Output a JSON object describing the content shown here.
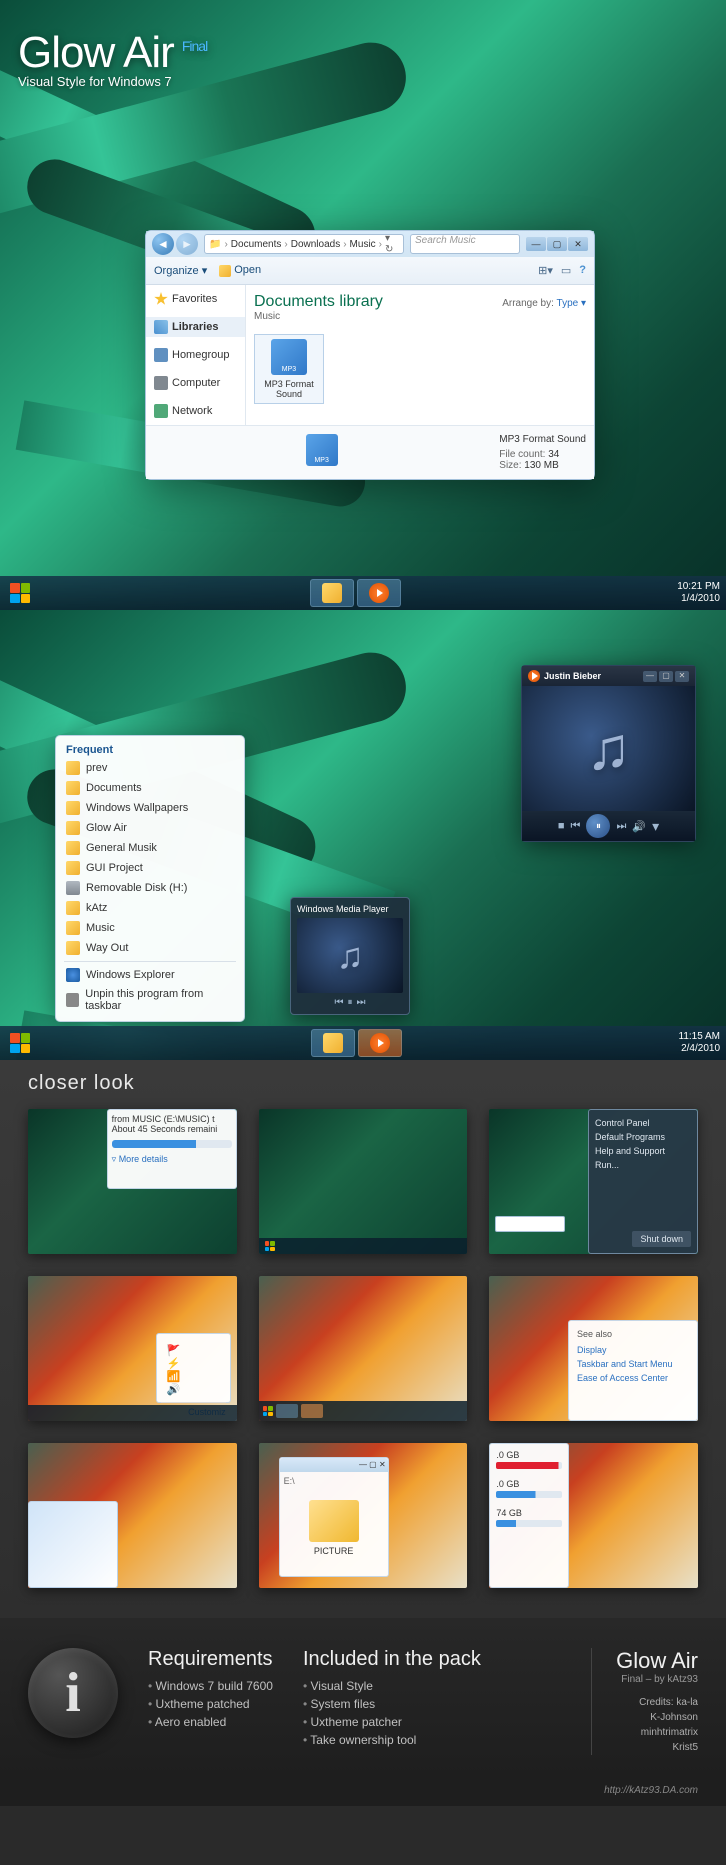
{
  "title": {
    "main": "Glow Air",
    "badge": "Final",
    "sub": "Visual Style for Windows 7"
  },
  "explorer": {
    "breadcrumb": [
      "Documents",
      "Downloads",
      "Music"
    ],
    "search_placeholder": "Search Music",
    "toolbar": {
      "organize": "Organize ▾",
      "open": "Open"
    },
    "toolbar_icons": {
      "view": "⊞▾",
      "preview": "▭",
      "help": "?"
    },
    "sidebar": {
      "favorites": "Favorites",
      "libraries": "Libraries",
      "homegroup": "Homegroup",
      "computer": "Computer",
      "network": "Network"
    },
    "header": {
      "title": "Documents library",
      "sub": "Music",
      "arrange": "Arrange by:",
      "arrange_val": "Type ▾"
    },
    "file": {
      "name": "MP3 Format Sound"
    },
    "details": {
      "name": "MP3 Format Sound",
      "count_label": "File count:",
      "count": "34",
      "size_label": "Size:",
      "size": "130 MB"
    }
  },
  "taskbar1": {
    "time": "10:21 PM",
    "date": "1/4/2010"
  },
  "media": {
    "title": "Justin Bieber",
    "ctrls": {
      "prev": "⏮",
      "play": "⏸",
      "next": "⏭",
      "stop": "■",
      "shuffle": "🔀",
      "vol": "🔊"
    }
  },
  "jumplist": {
    "header": "Frequent",
    "items": [
      "prev",
      "Documents",
      "Windows Wallpapers",
      "Glow Air",
      "General Musik",
      "GUI Project",
      "Removable Disk (H:)",
      "kAtz",
      "Music",
      "Way Out"
    ],
    "footer": [
      "Windows Explorer",
      "Unpin this program from taskbar"
    ]
  },
  "preview": {
    "title": "Windows Media Player"
  },
  "taskbar2": {
    "time": "11:15 AM",
    "date": "2/4/2010"
  },
  "closer": {
    "title": "closer look"
  },
  "thumbs": {
    "t1": {
      "line1": "from MUSIC (E:\\MUSIC) t",
      "line2": "About 45 Seconds remaini",
      "more": "More details"
    },
    "t3": {
      "items": [
        "Control Panel",
        "Default Programs",
        "Help and Support",
        "Run..."
      ],
      "shutdown": "Shut down"
    },
    "t4": {
      "customize": "Customiz"
    },
    "t6": {
      "header": "See also",
      "items": [
        "Display",
        "Taskbar and Start Menu",
        "Ease of Access Center"
      ]
    },
    "t8": {
      "label": "PICTURE"
    },
    "t9": {
      "d1": ".0 GB",
      "d2": ".0 GB",
      "d3": "74 GB"
    }
  },
  "info": {
    "req_title": "Requirements",
    "req": [
      "Windows 7 build 7600",
      "Uxtheme patched",
      "Aero enabled"
    ],
    "inc_title": "Included in the pack",
    "inc": [
      "Visual Style",
      "System files",
      "Uxtheme patcher",
      "Take ownership tool"
    ],
    "brand": "Glow Air",
    "brand_sub": "Final – by kAtz93",
    "credits_label": "Credits:",
    "credits": [
      "ka-la",
      "K-Johnson",
      "minhtrimatrix",
      "Krist5"
    ],
    "url": "http://kAtz93.DA.com"
  }
}
